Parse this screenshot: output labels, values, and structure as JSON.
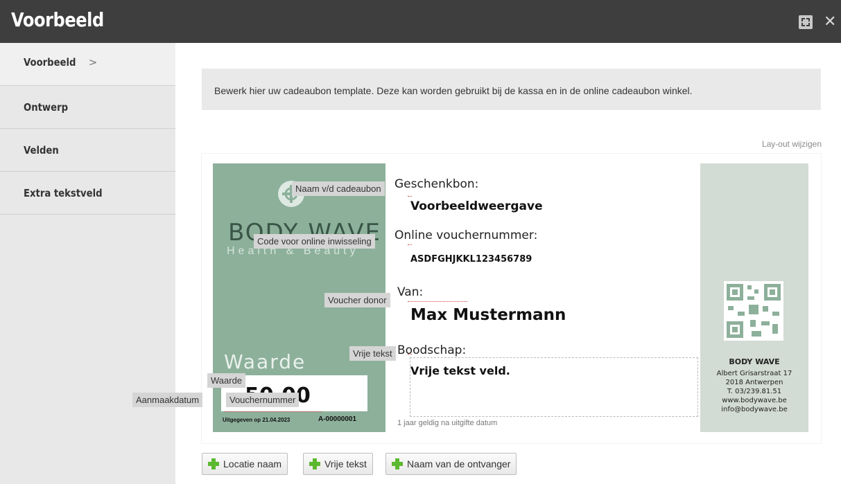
{
  "window": {
    "title": "Voorbeeld"
  },
  "icons": {
    "expand": "expand-icon",
    "close": "close-icon",
    "chevron": "chevron-right-icon",
    "plus": "plus-icon",
    "logo": "logo-icon",
    "qr": "qr-code-icon"
  },
  "sidebar": {
    "items": [
      {
        "label": "Voorbeeld",
        "chevron": ">"
      },
      {
        "label": "Ontwerp"
      },
      {
        "label": "Velden"
      },
      {
        "label": "Extra tekstveld"
      }
    ]
  },
  "main": {
    "info": "Bewerk hier uw cadeaubon template. Deze kan worden gebruikt bij de kassa en in de online cadeaubon winkel.",
    "layout_link": "Lay-out wijzigen"
  },
  "voucher": {
    "brand": "BODY WAVE",
    "brand_tagline": "Health & Beauty",
    "waarde_label": "Waarde",
    "amount": "50,00",
    "issued": "Uitgegeven op 21.04.2023",
    "voucher_number": "A-00000001",
    "gift_label": "Geschenkbon:",
    "gift_value": "Voorbeeldweergave",
    "online_label": "Online vouchernummer:",
    "online_value": "ASDFGHJKKL123456789",
    "from_label": "Van:",
    "from_value": "Max Mustermann",
    "message_label": "Boodschap:",
    "message_value": "Vrije tekst veld.",
    "valid": "1 jaar geldig na uitgifte datum",
    "company_name": "BODY WAVE",
    "company_lines": [
      "Albert Grisarstraat 17",
      "2018 Antwerpen",
      "T. 03/239.81.51",
      "www.bodywave.be",
      "info@bodywave.be"
    ],
    "accent_color": "#8db09b"
  },
  "field_tags": {
    "name": "Naam v/d cadeaubon",
    "code": "Code voor online inwisseling",
    "donor": "Voucher donor",
    "free_text": "Vrije tekst",
    "value": "Waarde",
    "created": "Aanmaakdatum",
    "number": "Vouchernummer"
  },
  "buttons": [
    {
      "label": "Locatie naam"
    },
    {
      "label": "Vrije tekst"
    },
    {
      "label": "Naam van de ontvanger"
    }
  ]
}
